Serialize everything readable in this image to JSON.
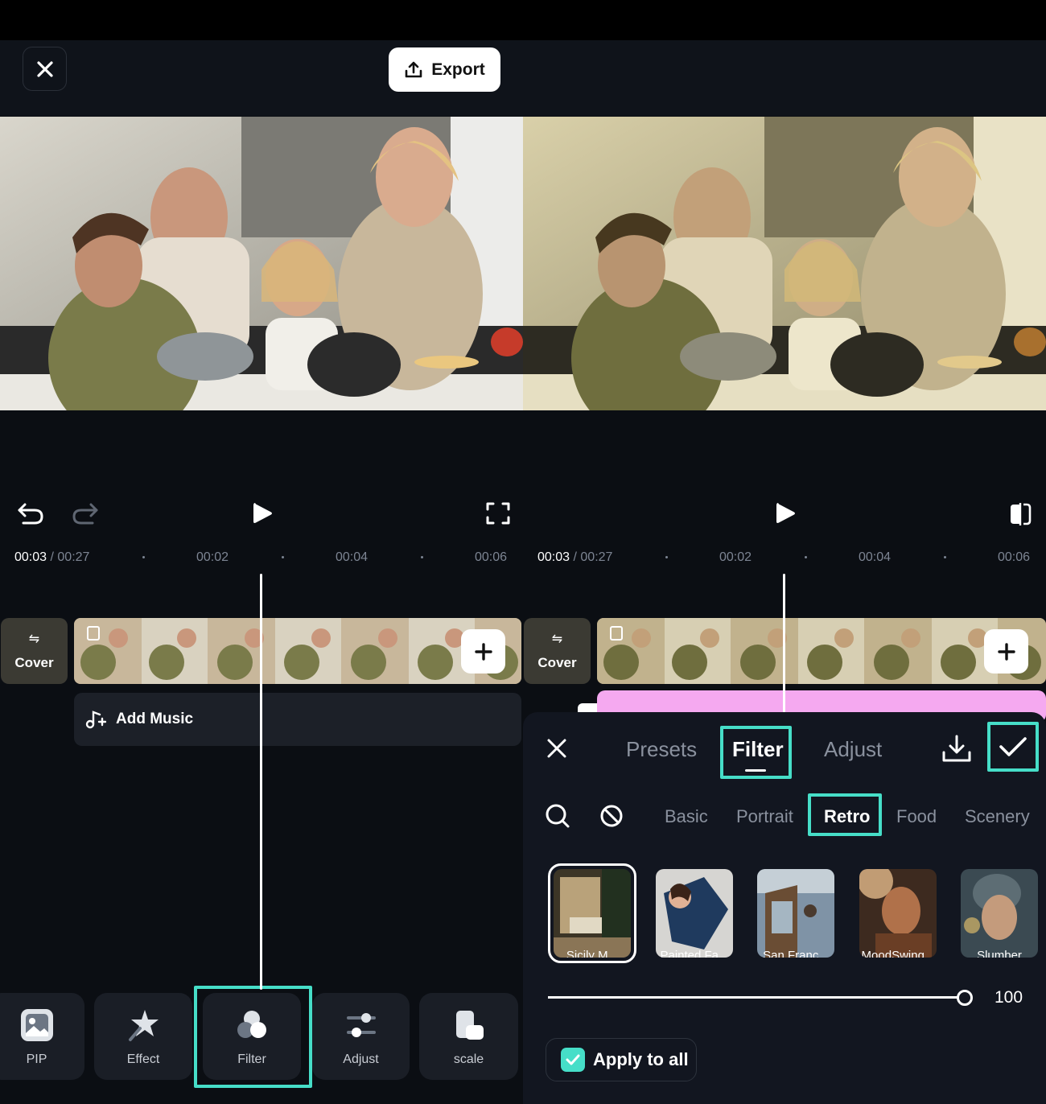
{
  "header": {
    "export_label": "Export"
  },
  "left": {
    "time_current": "00:03",
    "time_total": "/ 00:27",
    "ticks": [
      "00:02",
      "00:04",
      "00:06"
    ],
    "cover_label": "Cover",
    "add_music_label": "Add Music",
    "tools": [
      {
        "label": "PIP",
        "icon": "pip-icon"
      },
      {
        "label": "Effect",
        "icon": "effect-icon"
      },
      {
        "label": "Filter",
        "icon": "filter-icon"
      },
      {
        "label": "Adjust",
        "icon": "adjust-icon"
      },
      {
        "label": "scale",
        "icon": "scale-icon"
      }
    ]
  },
  "right": {
    "time_current": "00:03",
    "time_total": "/ 00:27",
    "ticks": [
      "00:02",
      "00:04",
      "00:06"
    ],
    "cover_label": "Cover",
    "tabs": [
      "Presets",
      "Filter",
      "Adjust"
    ],
    "active_tab": "Filter",
    "categories": [
      "Basic",
      "Portrait",
      "Retro",
      "Food",
      "Scenery"
    ],
    "active_category": "Retro",
    "filters": [
      "Sicily M...",
      "Painted Fa...",
      "San Franc...",
      "MoodSwing...",
      "Slumber"
    ],
    "intensity": 100,
    "intensity_label": "100",
    "apply_all_label": "Apply to all",
    "apply_all_checked": true
  },
  "colors": {
    "highlight": "#46dec8",
    "panel": "#121620",
    "audio_track": "#f5a9f0"
  }
}
